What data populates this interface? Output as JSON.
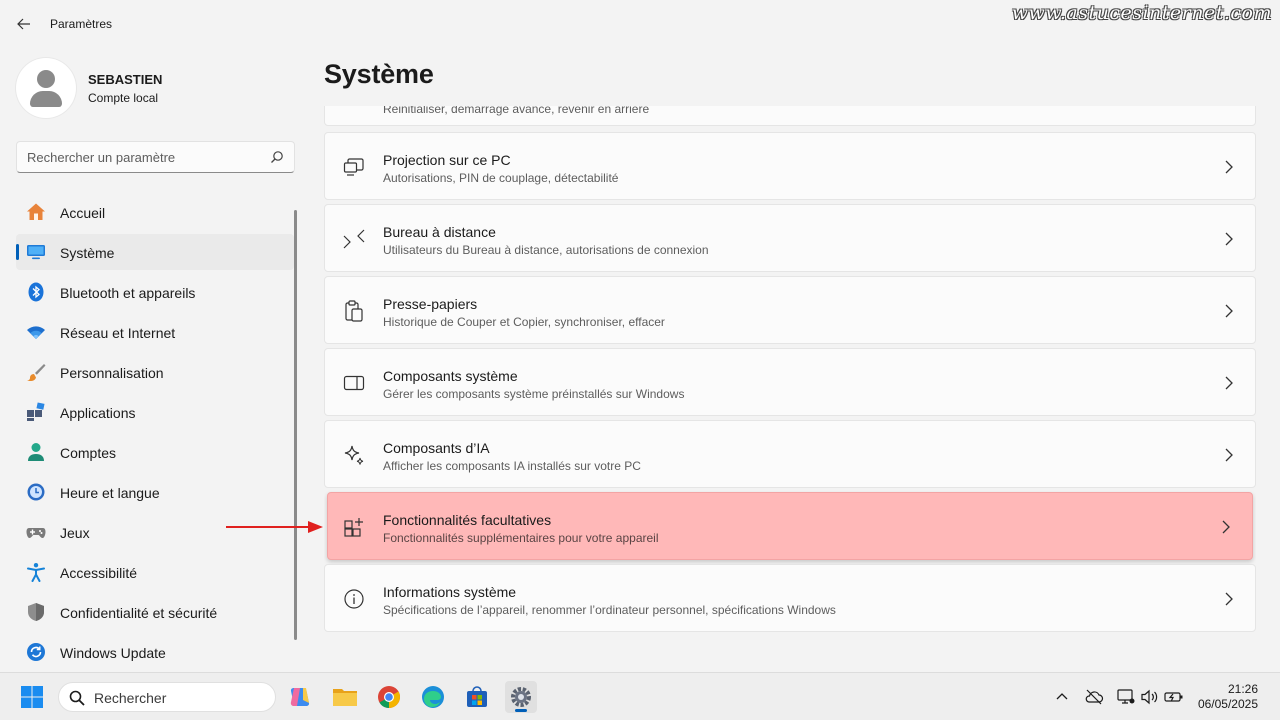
{
  "window": {
    "title": "Paramètres",
    "watermark": "www.astucesinternet.com"
  },
  "profile": {
    "name": "SEBASTIEN",
    "account_type": "Compte local"
  },
  "search": {
    "placeholder": "Rechercher un paramètre"
  },
  "sidebar": {
    "items": [
      {
        "label": "Accueil",
        "icon": "home-icon"
      },
      {
        "label": "Système",
        "icon": "monitor-icon",
        "active": true
      },
      {
        "label": "Bluetooth et appareils",
        "icon": "bluetooth-icon"
      },
      {
        "label": "Réseau et Internet",
        "icon": "wifi-icon"
      },
      {
        "label": "Personnalisation",
        "icon": "brush-icon"
      },
      {
        "label": "Applications",
        "icon": "apps-icon"
      },
      {
        "label": "Comptes",
        "icon": "person-icon"
      },
      {
        "label": "Heure et langue",
        "icon": "clock-globe-icon"
      },
      {
        "label": "Jeux",
        "icon": "gamepad-icon"
      },
      {
        "label": "Accessibilité",
        "icon": "accessibility-icon"
      },
      {
        "label": "Confidentialité et sécurité",
        "icon": "shield-icon"
      },
      {
        "label": "Windows Update",
        "icon": "update-icon"
      }
    ]
  },
  "main": {
    "title": "Système",
    "partial_subtitle": "Réinitialiser, démarrage avancé, revenir en arrière",
    "cards": [
      {
        "title": "Projection sur ce PC",
        "subtitle": "Autorisations, PIN de couplage, détectabilité",
        "icon": "projection-icon"
      },
      {
        "title": "Bureau à distance",
        "subtitle": "Utilisateurs du Bureau à distance, autorisations de connexion",
        "icon": "remote-desktop-icon"
      },
      {
        "title": "Presse-papiers",
        "subtitle": "Historique de Couper et Copier, synchroniser, effacer",
        "icon": "clipboard-icon"
      },
      {
        "title": "Composants système",
        "subtitle": "Gérer les composants système préinstallés sur Windows",
        "icon": "components-icon"
      },
      {
        "title": "Composants d’IA",
        "subtitle": "Afficher les composants IA installés sur votre PC",
        "icon": "sparkle-icon"
      },
      {
        "title": "Fonctionnalités facultatives",
        "subtitle": "Fonctionnalités supplémentaires pour votre appareil",
        "icon": "optional-features-icon",
        "highlighted": true
      },
      {
        "title": "Informations système",
        "subtitle": "Spécifications de l’appareil, renommer l’ordinateur personnel, spécifications Windows",
        "icon": "info-icon"
      }
    ]
  },
  "taskbar": {
    "search_label": "Rechercher",
    "apps": [
      "copilot-icon",
      "file-explorer-icon",
      "chrome-icon",
      "edge-icon",
      "store-icon",
      "settings-icon"
    ],
    "time": "21:26",
    "date": "06/05/2025"
  },
  "colors": {
    "accent": "#005fb8",
    "highlight": "#ffb8b8",
    "arrow": "#e0201e"
  }
}
